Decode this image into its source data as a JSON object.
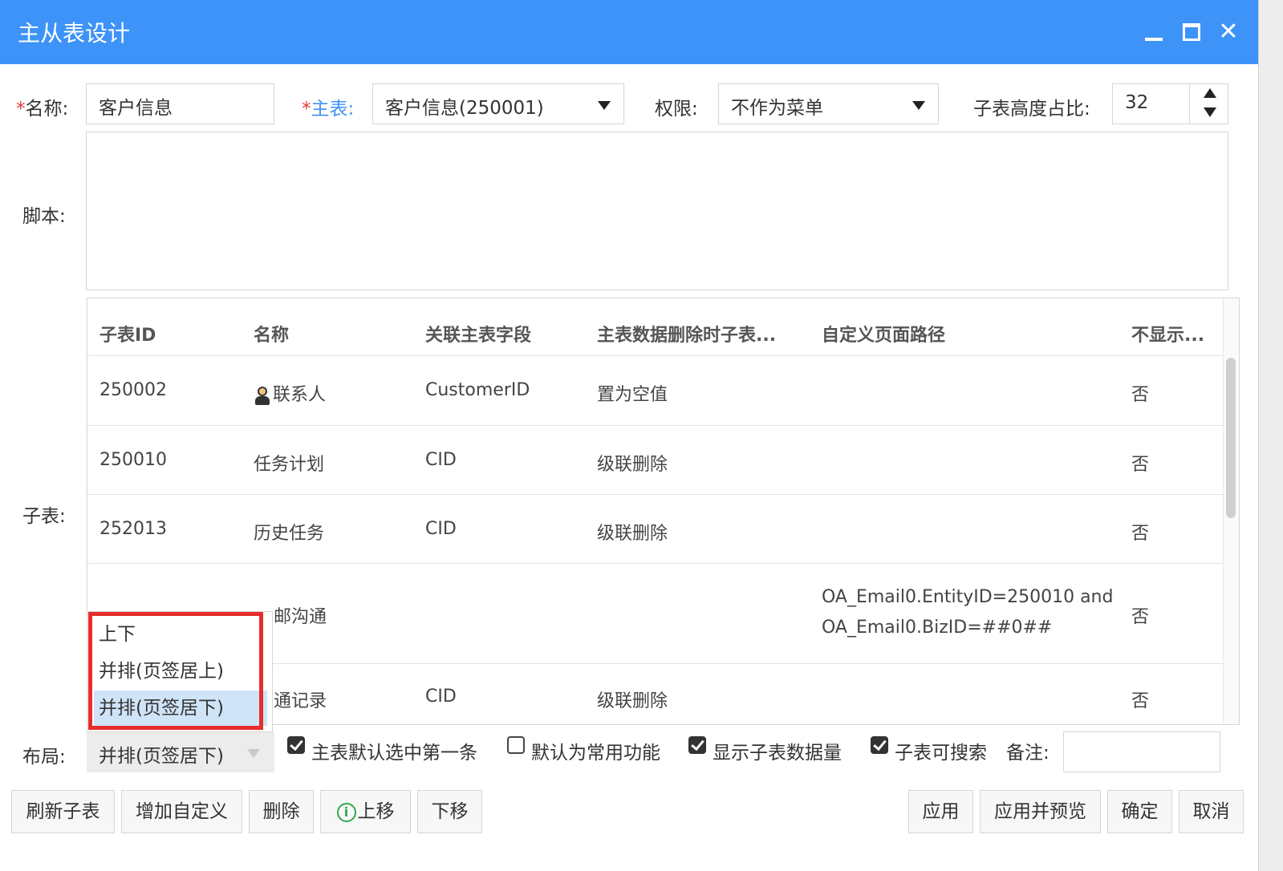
{
  "window": {
    "title": "主从表设计"
  },
  "form": {
    "name_label": "名称:",
    "name_value": "客户信息",
    "main_label": "主表:",
    "main_value": "客户信息(250001)",
    "perm_label": "权限:",
    "perm_value": "不作为菜单",
    "ratio_label": "子表高度占比:",
    "ratio_value": "32",
    "script_label": "脚本:",
    "subtable_label": "子表:",
    "layout_label": "布局:",
    "layout_value": "并排(页签居下)",
    "remark_label": "备注:"
  },
  "grid": {
    "headers": [
      "子表ID",
      "名称",
      "关联主表字段",
      "主表数据删除时子表...",
      "自定义页面路径",
      "不显示..."
    ],
    "rows": [
      {
        "id": "250002",
        "name": "联系人",
        "field": "CustomerID",
        "on_delete": "置为空值",
        "path": "",
        "hidden": "否"
      },
      {
        "id": "250010",
        "name": "任务计划",
        "field": "CID",
        "on_delete": "级联删除",
        "path": "",
        "hidden": "否"
      },
      {
        "id": "252013",
        "name": "历史任务",
        "field": "CID",
        "on_delete": "级联删除",
        "path": "",
        "hidden": "否"
      },
      {
        "id": "",
        "name": "邮沟通",
        "field": "",
        "on_delete": "",
        "path_line1": "OA_Email0.EntityID=250010 and",
        "path_line2": "OA_Email0.BizID=##0##",
        "hidden": "否"
      },
      {
        "id": "",
        "name": "通记录",
        "field": "CID",
        "on_delete": "级联删除",
        "path": "",
        "hidden": "否"
      }
    ]
  },
  "layout_dropdown": {
    "options": [
      "上下",
      "并排(页签居上)",
      "并排(页签居下)"
    ],
    "selected_index": 2
  },
  "checkboxes": [
    {
      "label": "主表默认选中第一条",
      "checked": true
    },
    {
      "label": "默认为常用功能",
      "checked": false
    },
    {
      "label": "显示子表数据量",
      "checked": true
    },
    {
      "label": "子表可搜索",
      "checked": true
    }
  ],
  "buttons": {
    "refresh": "刷新子表",
    "add_custom": "增加自定义",
    "delete": "删除",
    "move_up": "上移",
    "move_down": "下移",
    "apply": "应用",
    "apply_preview": "应用并预览",
    "ok": "确定",
    "cancel": "取消"
  },
  "colors": {
    "titlebar": "#3d93f7",
    "highlight": "#e82d2d",
    "selected": "#cfe4f7"
  }
}
